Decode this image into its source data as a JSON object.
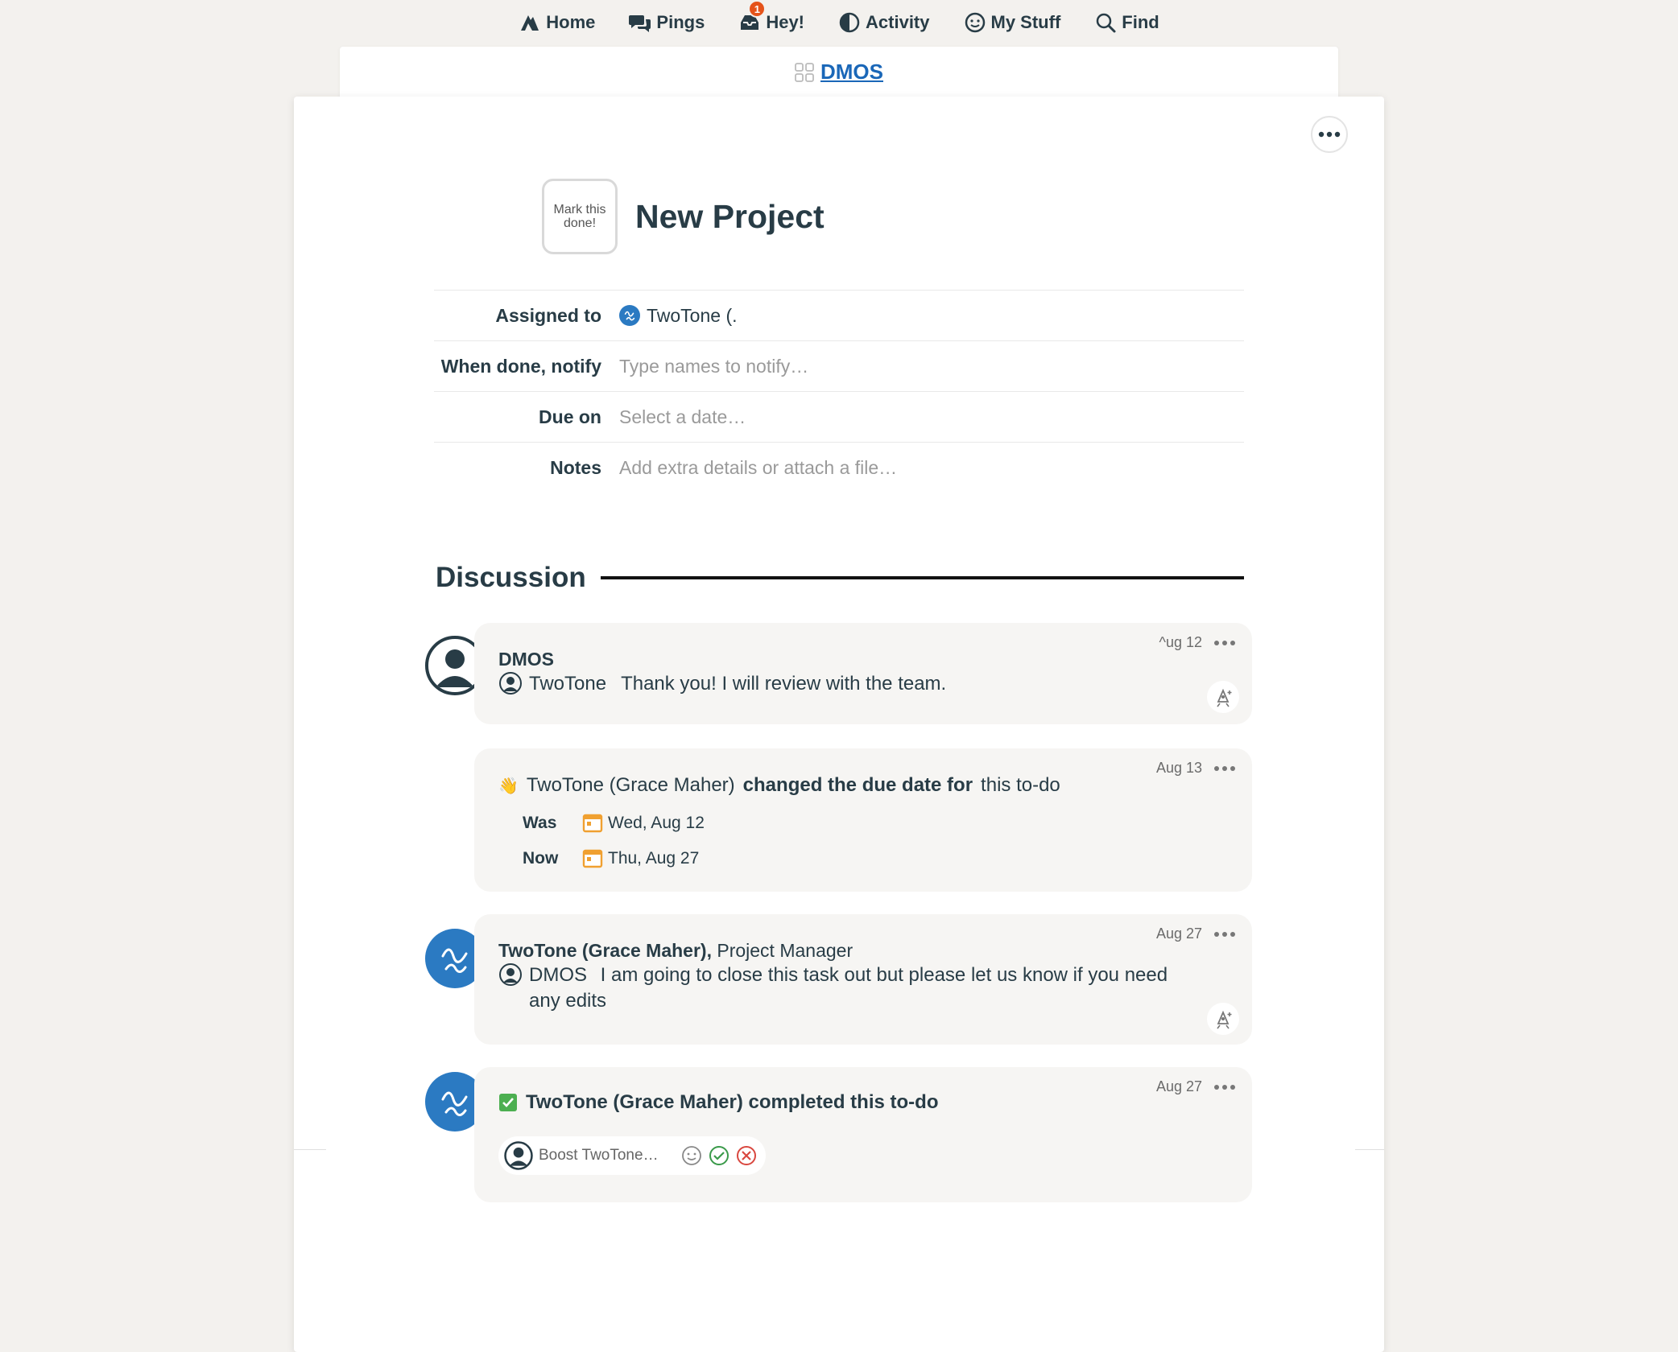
{
  "nav": {
    "items": [
      {
        "label": "Home",
        "icon": "home-icon"
      },
      {
        "label": "Pings",
        "icon": "pings-icon"
      },
      {
        "label": "Hey!",
        "icon": "hey-icon",
        "badge": "1"
      },
      {
        "label": "Activity",
        "icon": "activity-icon"
      },
      {
        "label": "My Stuff",
        "icon": "my-stuff-icon"
      },
      {
        "label": "Find",
        "icon": "search-icon"
      }
    ]
  },
  "project": {
    "name": "DMOS"
  },
  "todo": {
    "mark_done_label": "Mark this done!",
    "title": "New Project"
  },
  "fields": {
    "assigned_label": "Assigned to",
    "assigned_value": "TwoTone (.",
    "notify_label": "When done, notify",
    "notify_placeholder": "Type names to notify…",
    "due_label": "Due on",
    "due_placeholder": "Select a date…",
    "notes_label": "Notes",
    "notes_placeholder": "Add extra details or attach a file…"
  },
  "discussion": {
    "heading": "Discussion",
    "comments": [
      {
        "author": "DMOS",
        "date": "^ug 12",
        "mention": "TwoTone",
        "text": "Thank you! I will review with the team."
      },
      {
        "date": "Aug 13",
        "emoji": "👋",
        "actor": "TwoTone (Grace Maher)",
        "action": "changed the due date for",
        "object": "this to-do",
        "was_label": "Was",
        "was_value": "Wed, Aug 12",
        "now_label": "Now",
        "now_value": "Thu, Aug 27"
      },
      {
        "author": "TwoTone (Grace Maher),",
        "role": "Project Manager",
        "date": "Aug 27",
        "mention": "DMOS",
        "text_line1": "I am going to close this task out but please let us know if you need",
        "text_line2": "any edits"
      },
      {
        "date": "Aug 27",
        "text": "TwoTone (Grace Maher) completed this to-do",
        "boost_placeholder": "Boost TwoTone…"
      }
    ]
  },
  "colors": {
    "text": "#283c46",
    "link": "#1a67b8",
    "badge": "#e5531a",
    "avatar_blue": "#2b7ac2",
    "calendar_orange": "#f0a030",
    "check_green": "#4caf50"
  }
}
